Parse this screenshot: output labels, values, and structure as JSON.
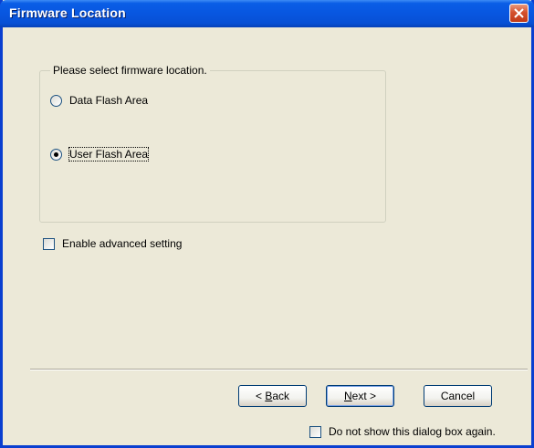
{
  "window": {
    "title": "Firmware Location"
  },
  "group": {
    "legend": "Please select firmware location.",
    "options": [
      {
        "label": "Data Flash Area",
        "selected": false
      },
      {
        "label": "User Flash Area",
        "selected": true
      }
    ]
  },
  "advanced": {
    "label": "Enable advanced setting",
    "checked": false
  },
  "buttons": {
    "back": {
      "prefix": "< ",
      "mnemonic": "B",
      "rest": "ack"
    },
    "next": {
      "mnemonic": "N",
      "rest": "ext >"
    },
    "cancel": "Cancel"
  },
  "footer": {
    "dont_show_label": "Do not show this dialog box again.",
    "checked": false
  },
  "colors": {
    "title_bar": "#0856e0",
    "dialog_bg": "#ece9d8",
    "close_button": "#d4512e"
  }
}
